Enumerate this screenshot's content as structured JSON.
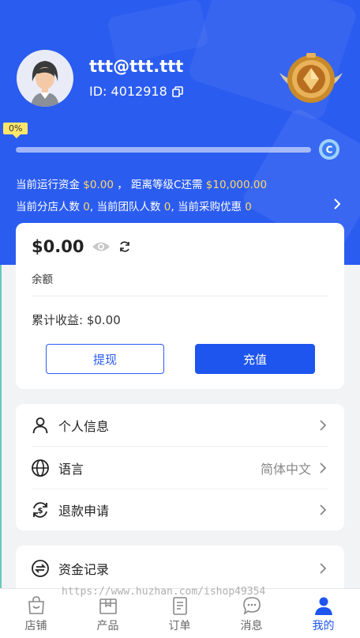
{
  "user": {
    "username": "ttt@ttt.ttt",
    "id_text": "ID: 4012918"
  },
  "level": {
    "progress_label": "0%",
    "progress_fraction": 0.0
  },
  "info": {
    "line1_prefix": "当前运行资金",
    "line1_value": "$0.00",
    "line1_mid": "，  距离等级C还需",
    "line1_value2": "$10,000.00",
    "line2_a": "当前分店人数",
    "line2_a_val": "0",
    "line2_b": ", 当前团队人数",
    "line2_b_val": "0",
    "line2_c": ", 当前采购优惠",
    "line2_c_val": "0"
  },
  "balance": {
    "amount": "$0.00",
    "label": "余额",
    "cumulative": "累计收益: $0.00",
    "withdraw_label": "提现",
    "recharge_label": "充值"
  },
  "menu": {
    "items": [
      {
        "label": "个人信息",
        "icon": "person-icon",
        "value": ""
      },
      {
        "label": "语言",
        "icon": "globe-icon",
        "value": "简体中文"
      },
      {
        "label": "退款申请",
        "icon": "refund-icon",
        "value": ""
      }
    ],
    "items2": [
      {
        "label": "资金记录",
        "icon": "funds-icon",
        "value": ""
      }
    ]
  },
  "watermark": "https://www.huzhan.com/ishop49354",
  "tabs": [
    {
      "label": "店铺",
      "icon": "shop-icon",
      "active": false
    },
    {
      "label": "产品",
      "icon": "product-icon",
      "active": false
    },
    {
      "label": "订单",
      "icon": "order-icon",
      "active": false
    },
    {
      "label": "消息",
      "icon": "message-icon",
      "active": false
    },
    {
      "label": "我的",
      "icon": "profile-icon",
      "active": true
    }
  ],
  "colors": {
    "primary": "#1e55ef",
    "hero": "#2b5cf0",
    "highlight": "#ffd966"
  }
}
